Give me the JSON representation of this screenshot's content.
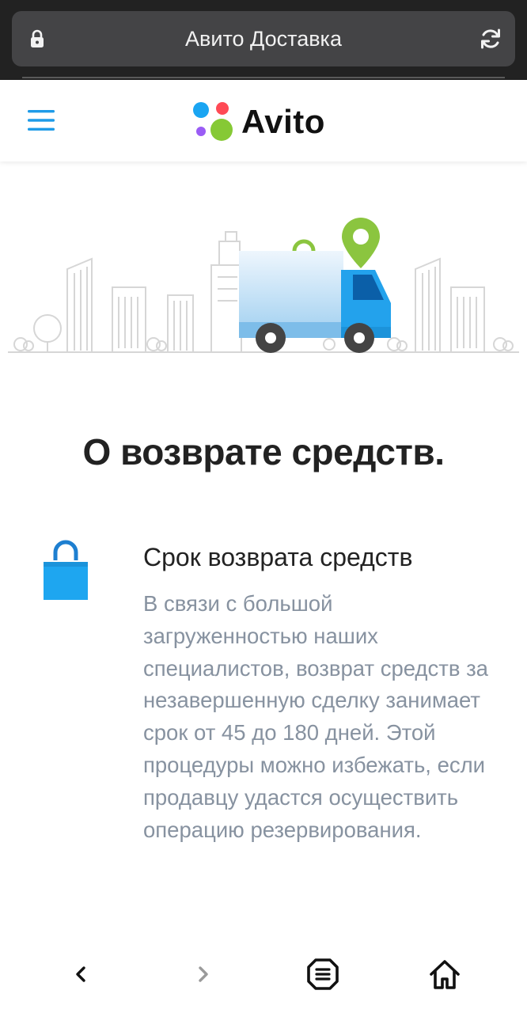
{
  "browser": {
    "url_title": "Авито Доставка"
  },
  "header": {
    "logo_text": "Avito"
  },
  "main": {
    "title": "О возврате средств.",
    "section": {
      "heading": "Срок возврата средств",
      "body": "В связи с большой загруженностью наших специалистов, возврат средств за незавершенную сделку занимает срок от 45 до 180 дней. Этой процедуры можно избежать, если продавцу удастся осуществить операцию резервирования."
    }
  },
  "icons": {
    "lock": "lock-icon",
    "reload": "reload-icon",
    "menu": "hamburger-menu-icon",
    "bag": "shopping-bag-icon",
    "back": "chevron-left-icon",
    "forward": "chevron-right-icon",
    "tabs": "tabs-icon",
    "home": "home-icon"
  },
  "colors": {
    "accent_blue": "#1e9be8",
    "logo_blue": "#1aa5f2",
    "logo_red": "#ff4a55",
    "logo_purple": "#9a5cf5",
    "logo_green": "#86c935",
    "body_text": "#8792a0",
    "title_text": "#222222"
  }
}
